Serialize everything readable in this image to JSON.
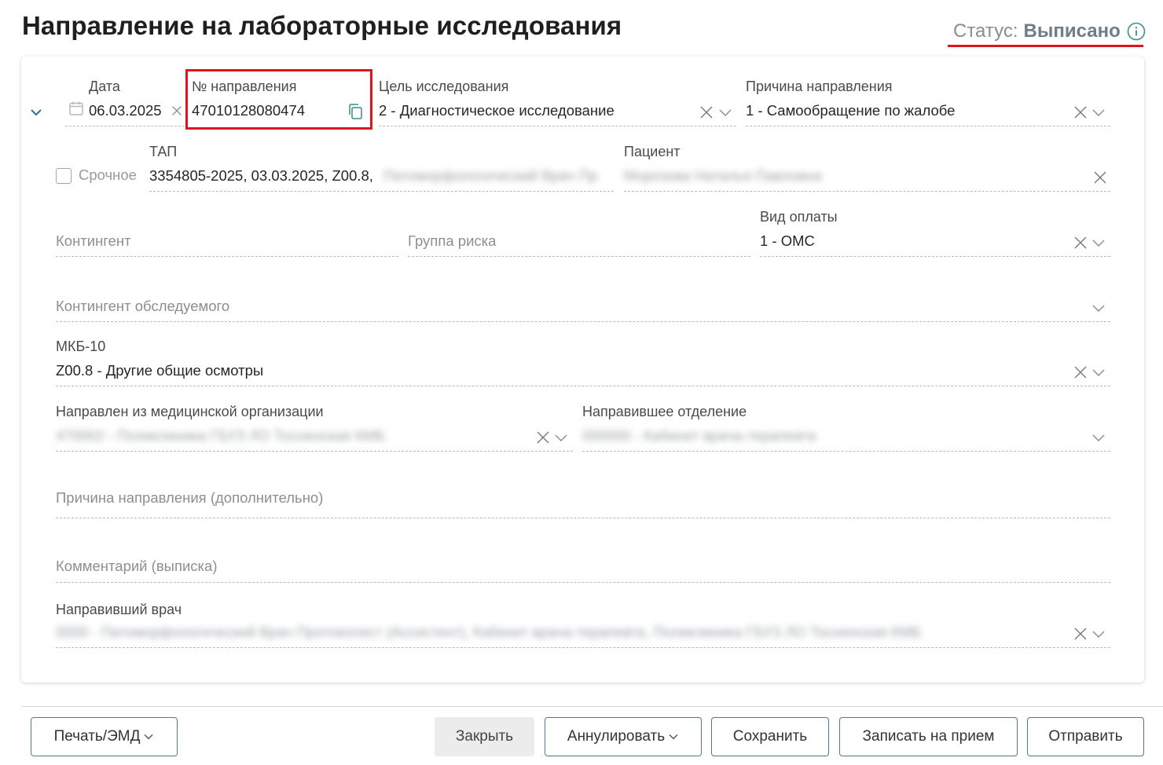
{
  "title": "Направление на лабораторные исследования",
  "status": {
    "label": "Статус:",
    "value": "Выписано"
  },
  "fields": {
    "date": {
      "label": "Дата",
      "value": "06.03.2025"
    },
    "referral_number": {
      "label": "№ направления",
      "value": "47010128080474"
    },
    "purpose": {
      "label": "Цель исследования",
      "value": "2 - Диагностическое исследование"
    },
    "reason": {
      "label": "Причина направления",
      "value": "1 - Самообращение по жалобе"
    },
    "urgent": {
      "label": "Срочное"
    },
    "tap": {
      "label": "ТАП",
      "value": "3354805-2025, 03.03.2025, Z00.8,",
      "value_hidden": "Патоморфологический Врач Пр"
    },
    "patient": {
      "label": "Пациент",
      "value_hidden": "Морозова Наталья Павловна"
    },
    "contingent": {
      "placeholder": "Контингент"
    },
    "risk_group": {
      "placeholder": "Группа риска"
    },
    "payment_type": {
      "label": "Вид оплаты",
      "value": "1 - ОМС"
    },
    "examinee_contingent": {
      "placeholder": "Контингент обследуемого"
    },
    "mkb10": {
      "label": "МКБ-10",
      "value": "Z00.8 - Другие общие осмотры"
    },
    "from_org": {
      "label": "Направлен из медицинской организации",
      "value_hidden": "470002 - Поликлиника ГБУЗ ЛО Тосненская КМБ"
    },
    "department": {
      "label": "Направившее отделение",
      "value_hidden": "000000 - Кабинет врача-терапевта"
    },
    "reason_extra": {
      "placeholder": "Причина направления (дополнительно)"
    },
    "comment": {
      "placeholder": "Комментарий (выписка)"
    },
    "doctor": {
      "label": "Направивший врач",
      "value_hidden": "0000 - Патоморфологический Врач Протоколист (Ассистент), Кабинет врача-терапевта, Поликлиника ГБУЗ ЛО Тосненская КМБ"
    }
  },
  "buttons": {
    "print": "Печать/ЭМД",
    "close": "Закрыть",
    "annul": "Аннулировать",
    "save": "Сохранить",
    "book": "Записать на прием",
    "send": "Отправить"
  },
  "colors": {
    "accent": "#4f7a96",
    "highlight": "#e0141e",
    "status_value": "#6f7d87"
  }
}
